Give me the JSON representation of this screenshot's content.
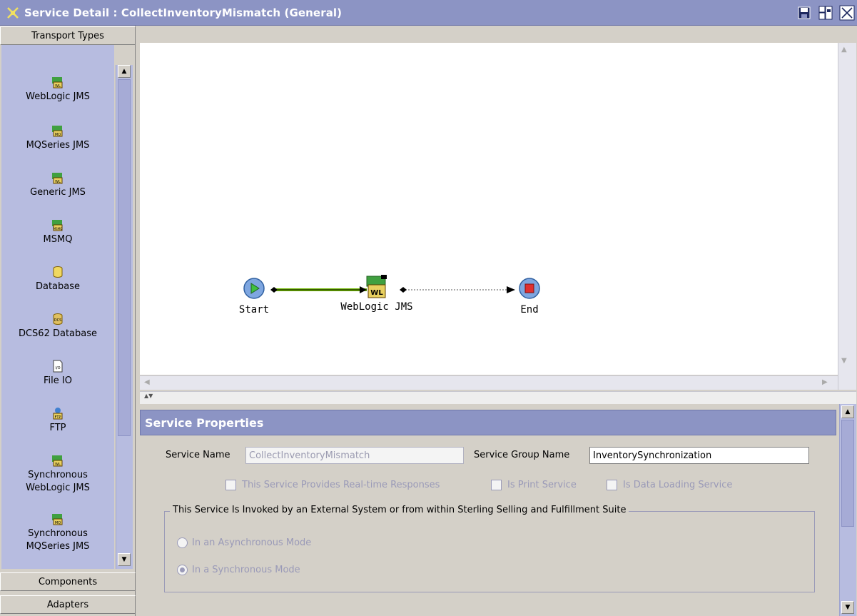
{
  "window": {
    "title": "Service Detail : CollectInventoryMismatch (General)",
    "icons": [
      "service-detail-icon",
      "save-icon",
      "dock-icon",
      "close-icon"
    ]
  },
  "palette": {
    "sections": {
      "transport_types": "Transport Types",
      "components": "Components",
      "adapters": "Adapters"
    },
    "items": [
      {
        "label": "WebLogic JMS",
        "icon": "weblogic-jms-icon"
      },
      {
        "label": "MQSeries JMS",
        "icon": "mqseries-jms-icon"
      },
      {
        "label": "Generic JMS",
        "icon": "generic-jms-icon"
      },
      {
        "label": "MSMQ",
        "icon": "msmq-icon"
      },
      {
        "label": "Database",
        "icon": "database-icon"
      },
      {
        "label": "DCS62 Database",
        "icon": "dcs62-database-icon"
      },
      {
        "label": "File IO",
        "icon": "file-io-icon"
      },
      {
        "label": "FTP",
        "icon": "ftp-icon"
      },
      {
        "label": "Synchronous WebLogic JMS",
        "icon": "sync-weblogic-jms-icon"
      },
      {
        "label": "Synchronous MQSeries JMS",
        "icon": "sync-mqseries-jms-icon"
      }
    ]
  },
  "flow": {
    "start_label": "Start",
    "middle_label": "WebLogic JMS",
    "end_label": "End"
  },
  "properties": {
    "header": "Service Properties",
    "service_name_label": "Service Name",
    "service_name_value": "CollectInventoryMismatch",
    "service_group_label": "Service Group Name",
    "service_group_value": "InventorySynchronization",
    "checkboxes": {
      "realtime": "This Service Provides Real-time Responses",
      "print": "Is Print Service",
      "data_loading": "Is Data Loading Service"
    },
    "invocation_group_title": "This Service Is Invoked by an External System or from within Sterling Selling and Fulfillment Suite",
    "radio_async": "In an Asynchronous Mode",
    "radio_sync": "In a Synchronous Mode",
    "selected_mode": "sync"
  },
  "colors": {
    "titlebar": "#8c94c4",
    "palette_bg": "#b7bce0",
    "connector_green": "#6fb800",
    "start_node": "#7ea6e0",
    "end_node": "#e03030"
  }
}
